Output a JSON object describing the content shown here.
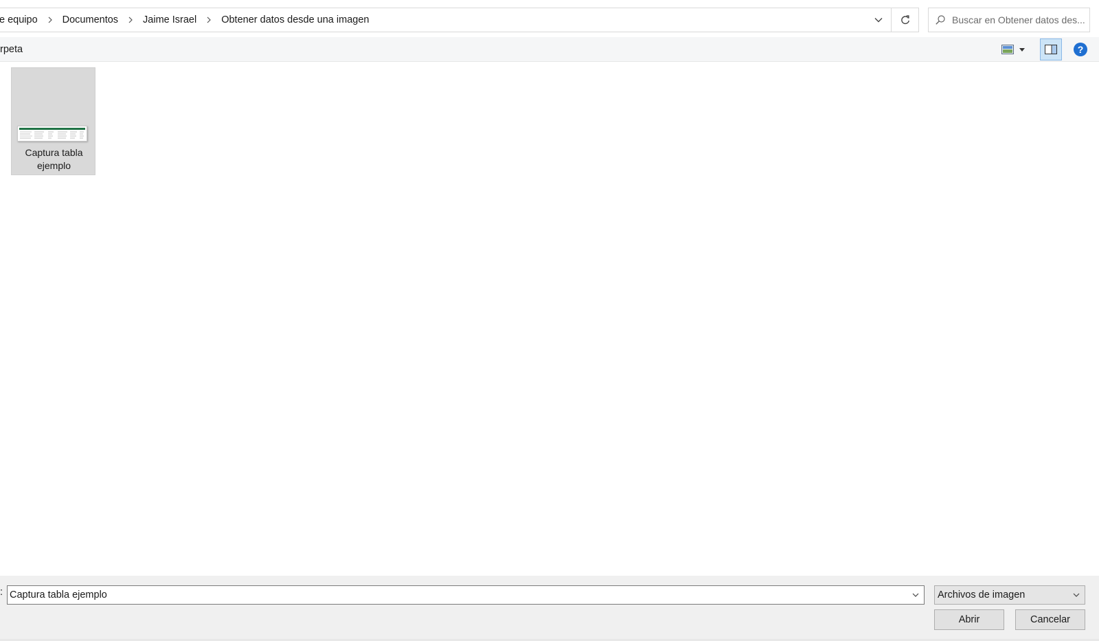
{
  "breadcrumb": {
    "items": [
      "e equipo",
      "Documentos",
      "Jaime Israel",
      "Obtener datos desde una imagen"
    ]
  },
  "search": {
    "placeholder": "Buscar en Obtener datos des..."
  },
  "toolbar": {
    "partial_label": "rpeta"
  },
  "files": [
    {
      "name": "Captura tabla ejemplo",
      "icon": "image-thumbnail"
    }
  ],
  "bottom": {
    "filename_label_partial": ":",
    "filename_value": "Captura tabla ejemplo",
    "filetype_selected": "Archivos de imagen",
    "open_label": "Abrir",
    "cancel_label": "Cancelar"
  },
  "colors": {
    "toolbar_bg": "#f5f6f7",
    "bottom_bg": "#f0f0f0",
    "selected_tile": "#d9d9d9",
    "pane_active": "#cce4f7",
    "help_blue": "#1f6fd1",
    "thumb_header_green": "#217346"
  }
}
